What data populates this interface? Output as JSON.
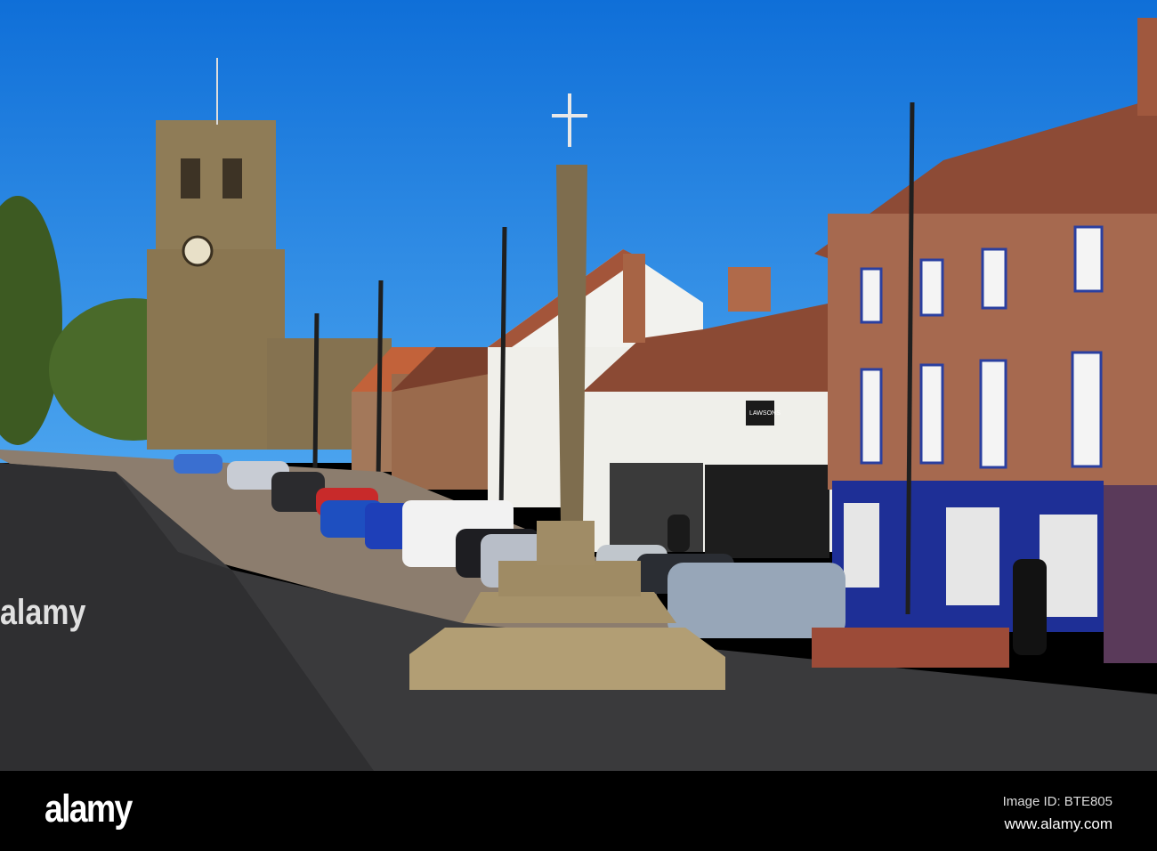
{
  "photo": {
    "shop_sign": "LAWSONS",
    "watermark": "alamy"
  },
  "footer": {
    "logo": "alamy",
    "image_id": "Image ID: BTE805",
    "url": "www.alamy.com"
  },
  "colors": {
    "sky": "#1a7fe0",
    "brick": "#a0664a",
    "road": "#3a3a3c",
    "stone": "#a89570"
  }
}
